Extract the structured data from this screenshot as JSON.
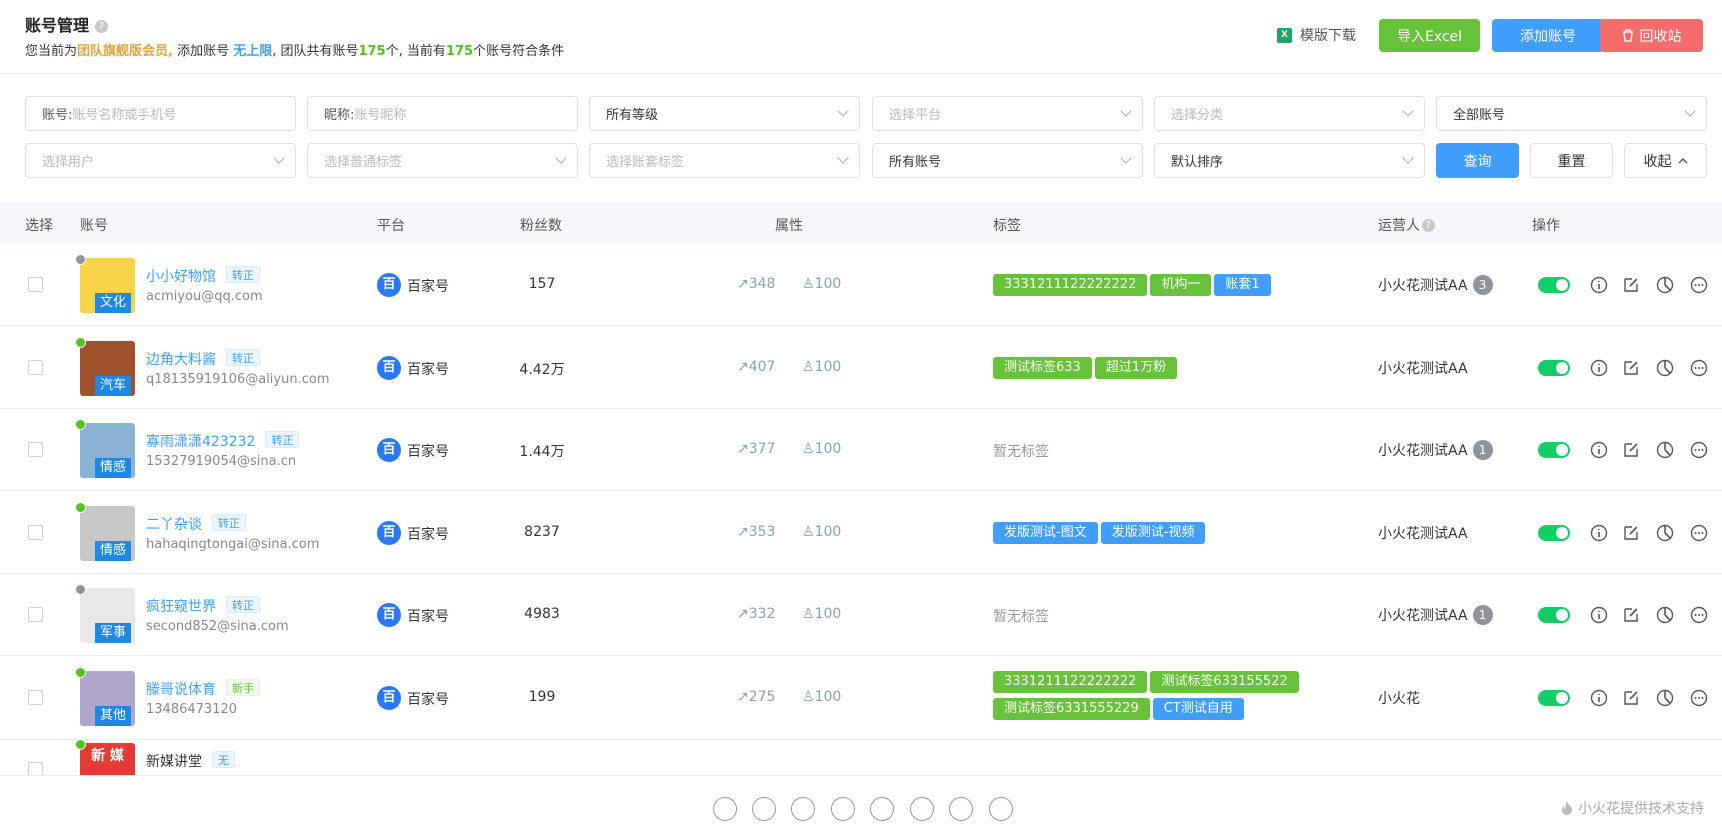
{
  "header": {
    "title": "账号管理",
    "help": "?",
    "sub_prefix": "您当前为",
    "member_level": "团队旗舰版会员,",
    "sub_add": " 添加账号 ",
    "add_limit": "无上限",
    "sub_team": ", 团队共有账号",
    "team_count": "175",
    "sub_unit": "个, 当前有",
    "match_count": "175",
    "sub_suffix": "个账号符合条件",
    "template_download": "模版下载",
    "xls_icon_text": "X",
    "import_excel": "导入Excel",
    "add_account": "添加账号",
    "recycle_bin": "回收站"
  },
  "filters": {
    "account_label": "账号: ",
    "account_placeholder": "账号名称或手机号",
    "nickname_label": "昵称: ",
    "nickname_placeholder": "账号昵称",
    "level": "所有等级",
    "platform": "选择平台",
    "category": "选择分类",
    "all_accounts": "全部账号",
    "user": "选择用户",
    "normal_tag": "选择普通标签",
    "set_tag": "选择账套标签",
    "account_scope": "所有账号",
    "sort": "默认排序",
    "query": "查询",
    "reset": "重置",
    "collapse": "收起"
  },
  "table": {
    "columns": {
      "select": "选择",
      "account": "账号",
      "platform": "平台",
      "fans": "粉丝数",
      "attr": "属性",
      "tags": "标签",
      "operator": "运营人",
      "actions": "操作"
    },
    "rows": [
      {
        "name": "小小好物馆",
        "badge": "转正",
        "email": "acmiyou@qq.com",
        "category": "文化",
        "platform": "百家号",
        "fans": "157",
        "trend": "348",
        "score": "100",
        "tags": [
          {
            "text": "3331211122222222",
            "color": "green"
          },
          {
            "text": "机构一",
            "color": "green"
          },
          {
            "text": "账套1",
            "color": "blue"
          }
        ],
        "operator": "小火花测试AA",
        "op_count": "3",
        "status": "gray"
      },
      {
        "name": "边角大料酱",
        "badge": "转正",
        "email": "q18135919106@aliyun.com",
        "category": "汽车",
        "platform": "百家号",
        "fans": "4.42万",
        "trend": "407",
        "score": "100",
        "tags": [
          {
            "text": "测试标签633",
            "color": "green"
          },
          {
            "text": "超过1万粉",
            "color": "green"
          }
        ],
        "operator": "小火花测试AA",
        "op_count": "",
        "status": "green"
      },
      {
        "name": "寡雨潇潇423232",
        "badge": "转正",
        "email": "15327919054@sina.cn",
        "category": "情感",
        "platform": "百家号",
        "fans": "1.44万",
        "trend": "377",
        "score": "100",
        "tags": [],
        "no_tag": "暂无标签",
        "operator": "小火花测试AA",
        "op_count": "1",
        "status": "green"
      },
      {
        "name": "二丫杂谈",
        "badge": "转正",
        "email": "hahaqingtongai@sina.com",
        "category": "情感",
        "platform": "百家号",
        "fans": "8237",
        "trend": "353",
        "score": "100",
        "tags": [
          {
            "text": "发版测试-图文",
            "color": "blue"
          },
          {
            "text": "发版测试-视频",
            "color": "blue"
          }
        ],
        "operator": "小火花测试AA",
        "op_count": "",
        "status": "green"
      },
      {
        "name": "疯狂窥世界",
        "badge": "转正",
        "email": "second852@sina.com",
        "category": "军事",
        "platform": "百家号",
        "fans": "4983",
        "trend": "332",
        "score": "100",
        "tags": [],
        "no_tag": "暂无标签",
        "operator": "小火花测试AA",
        "op_count": "1",
        "status": "gray"
      },
      {
        "name": "滕哥说体育",
        "badge": "新手",
        "email": "13486473120",
        "category": "其他",
        "platform": "百家号",
        "fans": "199",
        "trend": "275",
        "score": "100",
        "tags": [
          {
            "text": "3331211122222222",
            "color": "green"
          },
          {
            "text": "测试标签633155522",
            "color": "green"
          },
          {
            "text": "测试标签6331555229",
            "color": "green"
          },
          {
            "text": "CT测试自用",
            "color": "blue"
          }
        ],
        "operator": "小火花",
        "op_count": "",
        "status": "green"
      },
      {
        "name": "新媒讲堂",
        "badge": "无",
        "avatar_text": "新 媒",
        "status": "green"
      }
    ]
  },
  "footer": {
    "support": "小火花提供技术支持"
  },
  "colors": {
    "primary": "#409eff",
    "success": "#67c23a",
    "danger": "#f56c6c",
    "warning": "#e6a23c",
    "switch_on": "#13ce66"
  }
}
